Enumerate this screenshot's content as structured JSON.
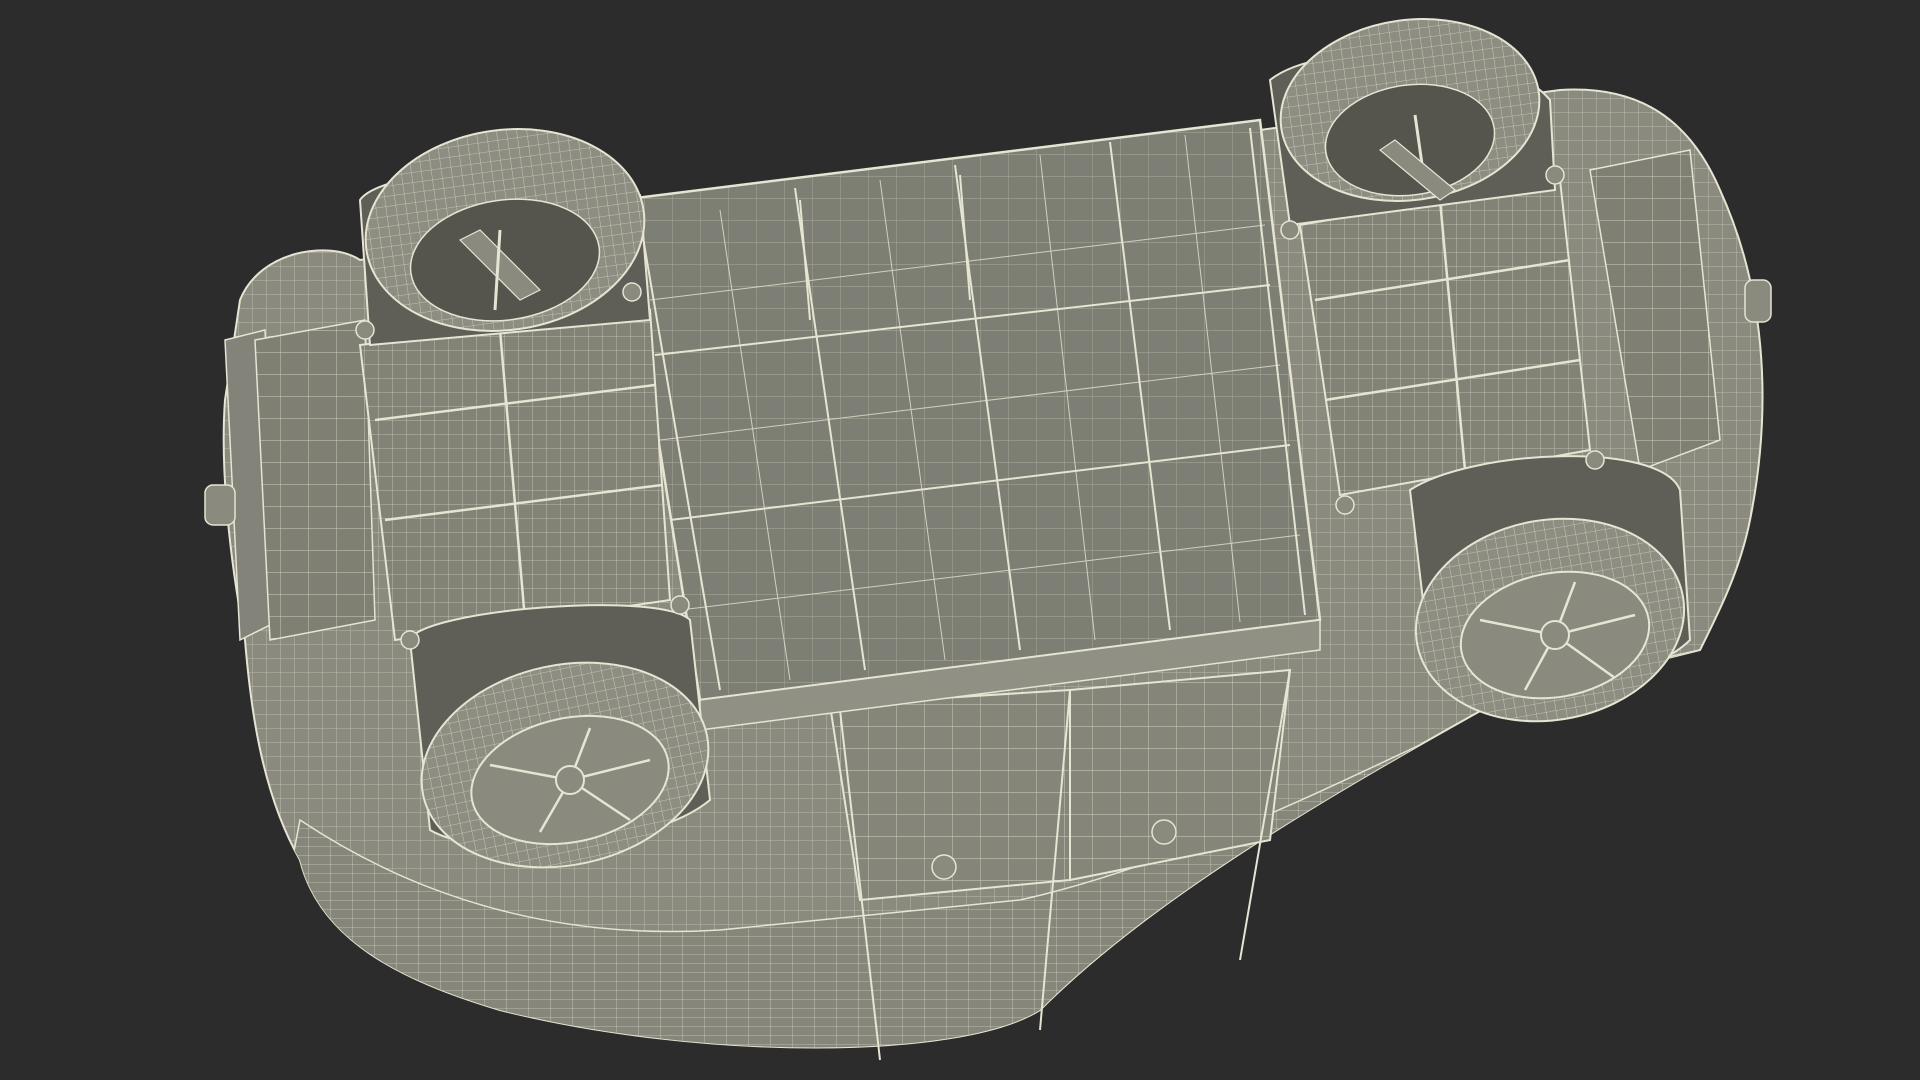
{
  "scene": {
    "background_color": "#2c2c2c",
    "model_fill_color": "#8a8a7f",
    "panel_fill_color": "#7e7f74",
    "wire_color": "#e6e4d2",
    "view": "underside",
    "render_mode": "wireframe-over-shaded"
  }
}
